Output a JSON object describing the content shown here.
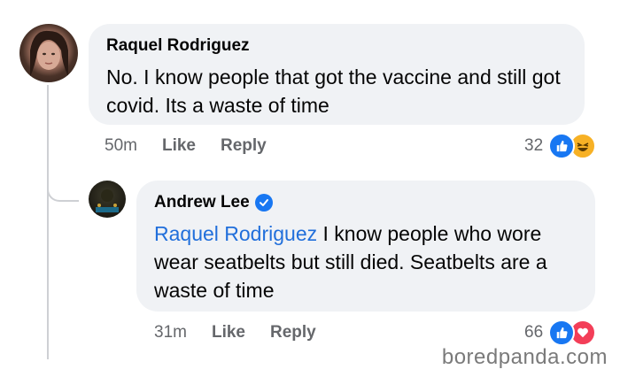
{
  "comments": [
    {
      "author": "Raquel Rodriguez",
      "text": "No. I know people that got the vaccine and still got covid. Its a waste of time",
      "time": "50m",
      "like_label": "Like",
      "reply_label": "Reply",
      "reaction_count": "32",
      "reactions": [
        "like-icon",
        "haha-icon"
      ]
    },
    {
      "author": "Andrew Lee",
      "verified": true,
      "mention": "Raquel Rodriguez",
      "text": " I know people who wore wear seatbelts but still died. Seatbelts are a waste of time",
      "time": "31m",
      "like_label": "Like",
      "reply_label": "Reply",
      "reaction_count": "66",
      "reactions": [
        "like-icon",
        "love-icon"
      ]
    }
  ],
  "watermark": "boredpanda.com",
  "colors": {
    "bubble": "#f0f2f5",
    "mention": "#216fdb",
    "like": "#1877f2",
    "love": "#f33e58",
    "haha": "#f7b125"
  }
}
